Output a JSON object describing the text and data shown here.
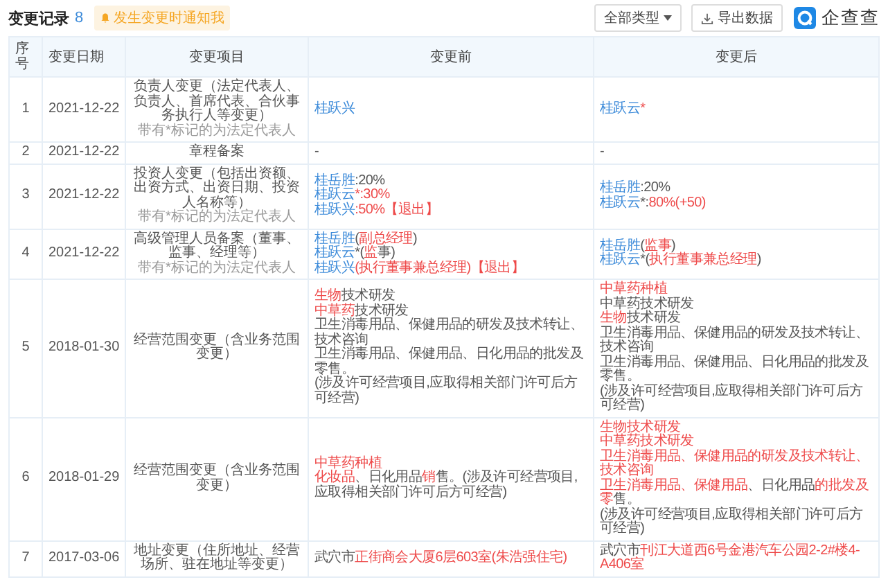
{
  "header": {
    "title": "变更记录",
    "count": "8",
    "notice": "发生变更时通知我",
    "filter": "全部类型",
    "export": "导出数据",
    "logo": "企查查"
  },
  "columns": [
    "序号",
    "变更日期",
    "变更项目",
    "变更前",
    "变更后"
  ],
  "rows": [
    {
      "index": "1",
      "date": "2021-12-22",
      "item": "负责人变更（法定代表人、负责人、首席代表、合伙事务执行人等变更）",
      "note": "带有*标记的为法定代表人",
      "before": [
        [
          {
            "kind": "name",
            "text": "桂跃兴"
          }
        ]
      ],
      "after": [
        [
          {
            "kind": "name",
            "text": "桂跃云"
          },
          {
            "kind": "diff",
            "text": "*"
          }
        ]
      ]
    },
    {
      "index": "2",
      "date": "2021-12-22",
      "item": "章程备案",
      "before": [
        [
          {
            "kind": "text",
            "text": "-"
          }
        ]
      ],
      "after": [
        [
          {
            "kind": "text",
            "text": "-"
          }
        ]
      ]
    },
    {
      "index": "3",
      "date": "2021-12-22",
      "item": "投资人变更（包括出资额、出资方式、出资日期、投资人名称等）",
      "note": "带有*标记的为法定代表人",
      "before": [
        [
          {
            "kind": "name",
            "text": "桂岳胜"
          },
          {
            "kind": "text",
            "text": ":20%"
          }
        ],
        [
          {
            "kind": "name",
            "text": "桂跃云"
          },
          {
            "kind": "diff",
            "text": "*:30%"
          }
        ],
        [
          {
            "kind": "name",
            "text": "桂跃兴"
          },
          {
            "kind": "diff",
            "text": ":50%【退出】"
          }
        ]
      ],
      "after": [
        [
          {
            "kind": "name",
            "text": "桂岳胜"
          },
          {
            "kind": "text",
            "text": ":20%"
          }
        ],
        [
          {
            "kind": "name",
            "text": "桂跃云"
          },
          {
            "kind": "text",
            "text": "*:"
          },
          {
            "kind": "diff",
            "text": "80%(+50)"
          }
        ]
      ]
    },
    {
      "index": "4",
      "date": "2021-12-22",
      "item": "高级管理人员备案（董事、监事、经理等）",
      "note": "带有*标记的为法定代表人",
      "before": [
        [
          {
            "kind": "name",
            "text": "桂岳胜"
          },
          {
            "kind": "text",
            "text": "("
          },
          {
            "kind": "diff",
            "text": "副总经理"
          },
          {
            "kind": "text",
            "text": ")"
          }
        ],
        [
          {
            "kind": "name",
            "text": "桂跃云"
          },
          {
            "kind": "text",
            "text": "*("
          },
          {
            "kind": "diff",
            "text": "监"
          },
          {
            "kind": "text",
            "text": "事)"
          }
        ],
        [
          {
            "kind": "name",
            "text": "桂跃兴"
          },
          {
            "kind": "diff",
            "text": "(执行董事兼总经理)【退出】"
          }
        ]
      ],
      "after": [
        [
          {
            "kind": "name",
            "text": "桂岳胜"
          },
          {
            "kind": "text",
            "text": "("
          },
          {
            "kind": "diff",
            "text": "监事"
          },
          {
            "kind": "text",
            "text": ")"
          }
        ],
        [
          {
            "kind": "name",
            "text": "桂跃云"
          },
          {
            "kind": "text",
            "text": "*("
          },
          {
            "kind": "diff",
            "text": "执行董事兼总经理"
          },
          {
            "kind": "text",
            "text": ")"
          }
        ]
      ]
    },
    {
      "index": "5",
      "date": "2018-01-30",
      "item": "经营范围变更（含业务范围变更）",
      "before": [
        [
          {
            "kind": "diff",
            "text": "生物"
          },
          {
            "kind": "text",
            "text": "技术研发"
          }
        ],
        [
          {
            "kind": "diff",
            "text": "中草药"
          },
          {
            "kind": "text",
            "text": "技术研发"
          }
        ],
        [
          {
            "kind": "text",
            "text": "卫生消毒用品、保健用品的研发及技术转让、技术咨询"
          }
        ],
        [
          {
            "kind": "text",
            "text": "卫生消毒用品、保健用品、日化用品的批发及零售。"
          }
        ],
        [
          {
            "kind": "text",
            "text": "(涉及许可经营项目,应取得相关部门许可后方可经营)"
          }
        ]
      ],
      "after": [
        [
          {
            "kind": "diff",
            "text": "中草药种植"
          }
        ],
        [
          {
            "kind": "text",
            "text": "中草药技术研发"
          }
        ],
        [
          {
            "kind": "diff",
            "text": "生物"
          },
          {
            "kind": "text",
            "text": "技术研发"
          }
        ],
        [
          {
            "kind": "text",
            "text": "卫生消毒用品、保健用品的研发及技术转让、技术咨询"
          }
        ],
        [
          {
            "kind": "text",
            "text": "卫生消毒用品、保健用品、日化用品的批发及零售。"
          }
        ],
        [
          {
            "kind": "text",
            "text": "(涉及许可经营项目,应取得相关部门许可后方可经营)"
          }
        ]
      ]
    },
    {
      "index": "6",
      "date": "2018-01-29",
      "item": "经营范围变更（含业务范围变更）",
      "before": [
        [
          {
            "kind": "diff",
            "text": "中草药种植"
          }
        ],
        [
          {
            "kind": "diff",
            "text": "化妆品"
          },
          {
            "kind": "text",
            "text": "、日化用品"
          },
          {
            "kind": "diff",
            "text": "销"
          },
          {
            "kind": "text",
            "text": "售。(涉及许可经营项目,应取得相关部门许可后方可经营)"
          }
        ]
      ],
      "after": [
        [
          {
            "kind": "diff",
            "text": "生物技术研发"
          }
        ],
        [
          {
            "kind": "diff",
            "text": "中草药技术研发"
          }
        ],
        [
          {
            "kind": "diff",
            "text": "卫生消毒用品、保健用品的研发及技术转让、技术咨询"
          }
        ],
        [
          {
            "kind": "diff",
            "text": "卫生消毒用品、保健用品"
          },
          {
            "kind": "text",
            "text": "、日化用品"
          },
          {
            "kind": "diff",
            "text": "的批发及零"
          },
          {
            "kind": "text",
            "text": "售。"
          }
        ],
        [
          {
            "kind": "text",
            "text": "(涉及许可经营项目,应取得相关部门许可后方可经营)"
          }
        ]
      ]
    },
    {
      "index": "7",
      "date": "2017-03-06",
      "item": "地址变更（住所地址、经营场所、驻在地址等变更）",
      "before": [
        [
          {
            "kind": "text",
            "text": "武穴市"
          },
          {
            "kind": "diff",
            "text": "正街商会大厦6层603室(朱浩强住宅)"
          }
        ]
      ],
      "after": [
        [
          {
            "kind": "text",
            "text": "武穴市"
          },
          {
            "kind": "diff",
            "text": "刊江大道西6号金港汽车公园2-2#楼4-A406室"
          }
        ]
      ]
    }
  ]
}
